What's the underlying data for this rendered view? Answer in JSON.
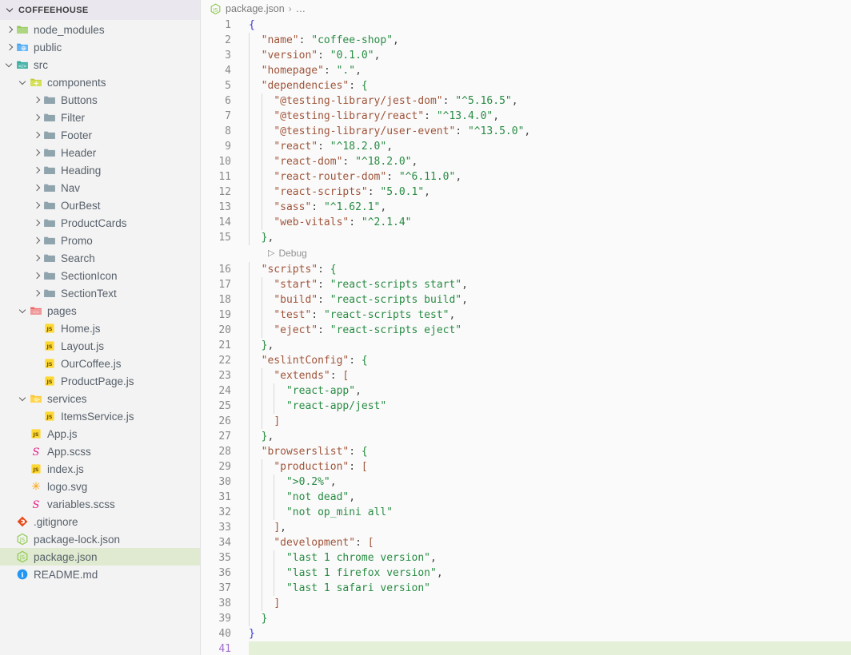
{
  "sidebar": {
    "title": "COFFEEHOUSE",
    "items": [
      {
        "label": "node_modules",
        "depth": 1,
        "kind": "folder",
        "icon": "folder-node-modules-icon",
        "state": "collapsed"
      },
      {
        "label": "public",
        "depth": 1,
        "kind": "folder",
        "icon": "folder-public-icon",
        "state": "collapsed"
      },
      {
        "label": "src",
        "depth": 1,
        "kind": "folder",
        "icon": "folder-src-icon",
        "state": "expanded"
      },
      {
        "label": "components",
        "depth": 2,
        "kind": "folder",
        "icon": "folder-components-icon",
        "state": "expanded"
      },
      {
        "label": "Buttons",
        "depth": 3,
        "kind": "folder",
        "icon": "folder-icon",
        "state": "collapsed"
      },
      {
        "label": "Filter",
        "depth": 3,
        "kind": "folder",
        "icon": "folder-icon",
        "state": "collapsed"
      },
      {
        "label": "Footer",
        "depth": 3,
        "kind": "folder",
        "icon": "folder-icon",
        "state": "collapsed"
      },
      {
        "label": "Header",
        "depth": 3,
        "kind": "folder",
        "icon": "folder-icon",
        "state": "collapsed"
      },
      {
        "label": "Heading",
        "depth": 3,
        "kind": "folder",
        "icon": "folder-icon",
        "state": "collapsed"
      },
      {
        "label": "Nav",
        "depth": 3,
        "kind": "folder",
        "icon": "folder-icon",
        "state": "collapsed"
      },
      {
        "label": "OurBest",
        "depth": 3,
        "kind": "folder",
        "icon": "folder-icon",
        "state": "collapsed"
      },
      {
        "label": "ProductCards",
        "depth": 3,
        "kind": "folder",
        "icon": "folder-icon",
        "state": "collapsed"
      },
      {
        "label": "Promo",
        "depth": 3,
        "kind": "folder",
        "icon": "folder-icon",
        "state": "collapsed"
      },
      {
        "label": "Search",
        "depth": 3,
        "kind": "folder",
        "icon": "folder-icon",
        "state": "collapsed"
      },
      {
        "label": "SectionIcon",
        "depth": 3,
        "kind": "folder",
        "icon": "folder-icon",
        "state": "collapsed"
      },
      {
        "label": "SectionText",
        "depth": 3,
        "kind": "folder",
        "icon": "folder-icon",
        "state": "collapsed"
      },
      {
        "label": "pages",
        "depth": 2,
        "kind": "folder",
        "icon": "folder-pages-icon",
        "state": "expanded"
      },
      {
        "label": "Home.js",
        "depth": 3,
        "kind": "file",
        "icon": "js-file-icon"
      },
      {
        "label": "Layout.js",
        "depth": 3,
        "kind": "file",
        "icon": "js-file-icon"
      },
      {
        "label": "OurCoffee.js",
        "depth": 3,
        "kind": "file",
        "icon": "js-file-icon"
      },
      {
        "label": "ProductPage.js",
        "depth": 3,
        "kind": "file",
        "icon": "js-file-icon"
      },
      {
        "label": "services",
        "depth": 2,
        "kind": "folder",
        "icon": "folder-services-icon",
        "state": "expanded"
      },
      {
        "label": "ItemsService.js",
        "depth": 3,
        "kind": "file",
        "icon": "js-file-icon"
      },
      {
        "label": "App.js",
        "depth": 2,
        "kind": "file",
        "icon": "js-file-icon"
      },
      {
        "label": "App.scss",
        "depth": 2,
        "kind": "file",
        "icon": "sass-file-icon"
      },
      {
        "label": "index.js",
        "depth": 2,
        "kind": "file",
        "icon": "js-file-icon"
      },
      {
        "label": "logo.svg",
        "depth": 2,
        "kind": "file",
        "icon": "svg-file-icon"
      },
      {
        "label": "variables.scss",
        "depth": 2,
        "kind": "file",
        "icon": "sass-file-icon"
      },
      {
        "label": ".gitignore",
        "depth": 1,
        "kind": "file",
        "icon": "git-file-icon"
      },
      {
        "label": "package-lock.json",
        "depth": 1,
        "kind": "file",
        "icon": "nodejs-file-icon"
      },
      {
        "label": "package.json",
        "depth": 1,
        "kind": "file",
        "icon": "nodejs-file-icon",
        "selected": true
      },
      {
        "label": "README.md",
        "depth": 1,
        "kind": "file",
        "icon": "info-file-icon"
      }
    ]
  },
  "editor": {
    "breadcrumb": {
      "file": "package.json",
      "separator": "›",
      "overflow": "…"
    },
    "codelens": {
      "label": "Debug",
      "after_line": 15
    },
    "active_line": 41,
    "lines": [
      {
        "n": 1,
        "indent": 0,
        "tokens": [
          {
            "t": "brace",
            "v": "{"
          }
        ]
      },
      {
        "n": 2,
        "indent": 1,
        "tokens": [
          {
            "t": "key",
            "v": "\"name\""
          },
          {
            "t": "punc",
            "v": ": "
          },
          {
            "t": "str",
            "v": "\"coffee-shop\""
          },
          {
            "t": "punc",
            "v": ","
          }
        ]
      },
      {
        "n": 3,
        "indent": 1,
        "tokens": [
          {
            "t": "key",
            "v": "\"version\""
          },
          {
            "t": "punc",
            "v": ": "
          },
          {
            "t": "str",
            "v": "\"0.1.0\""
          },
          {
            "t": "punc",
            "v": ","
          }
        ]
      },
      {
        "n": 4,
        "indent": 1,
        "tokens": [
          {
            "t": "key",
            "v": "\"homepage\""
          },
          {
            "t": "punc",
            "v": ": "
          },
          {
            "t": "str",
            "v": "\".\""
          },
          {
            "t": "punc",
            "v": ","
          }
        ]
      },
      {
        "n": 5,
        "indent": 1,
        "tokens": [
          {
            "t": "key",
            "v": "\"dependencies\""
          },
          {
            "t": "punc",
            "v": ": "
          },
          {
            "t": "brace2",
            "v": "{"
          }
        ]
      },
      {
        "n": 6,
        "indent": 2,
        "tokens": [
          {
            "t": "key",
            "v": "\"@testing-library/jest-dom\""
          },
          {
            "t": "punc",
            "v": ": "
          },
          {
            "t": "str",
            "v": "\"^5.16.5\""
          },
          {
            "t": "punc",
            "v": ","
          }
        ]
      },
      {
        "n": 7,
        "indent": 2,
        "tokens": [
          {
            "t": "key",
            "v": "\"@testing-library/react\""
          },
          {
            "t": "punc",
            "v": ": "
          },
          {
            "t": "str",
            "v": "\"^13.4.0\""
          },
          {
            "t": "punc",
            "v": ","
          }
        ]
      },
      {
        "n": 8,
        "indent": 2,
        "tokens": [
          {
            "t": "key",
            "v": "\"@testing-library/user-event\""
          },
          {
            "t": "punc",
            "v": ": "
          },
          {
            "t": "str",
            "v": "\"^13.5.0\""
          },
          {
            "t": "punc",
            "v": ","
          }
        ]
      },
      {
        "n": 9,
        "indent": 2,
        "tokens": [
          {
            "t": "key",
            "v": "\"react\""
          },
          {
            "t": "punc",
            "v": ": "
          },
          {
            "t": "str",
            "v": "\"^18.2.0\""
          },
          {
            "t": "punc",
            "v": ","
          }
        ]
      },
      {
        "n": 10,
        "indent": 2,
        "tokens": [
          {
            "t": "key",
            "v": "\"react-dom\""
          },
          {
            "t": "punc",
            "v": ": "
          },
          {
            "t": "str",
            "v": "\"^18.2.0\""
          },
          {
            "t": "punc",
            "v": ","
          }
        ]
      },
      {
        "n": 11,
        "indent": 2,
        "tokens": [
          {
            "t": "key",
            "v": "\"react-router-dom\""
          },
          {
            "t": "punc",
            "v": ": "
          },
          {
            "t": "str",
            "v": "\"^6.11.0\""
          },
          {
            "t": "punc",
            "v": ","
          }
        ]
      },
      {
        "n": 12,
        "indent": 2,
        "tokens": [
          {
            "t": "key",
            "v": "\"react-scripts\""
          },
          {
            "t": "punc",
            "v": ": "
          },
          {
            "t": "str",
            "v": "\"5.0.1\""
          },
          {
            "t": "punc",
            "v": ","
          }
        ]
      },
      {
        "n": 13,
        "indent": 2,
        "tokens": [
          {
            "t": "key",
            "v": "\"sass\""
          },
          {
            "t": "punc",
            "v": ": "
          },
          {
            "t": "str",
            "v": "\"^1.62.1\""
          },
          {
            "t": "punc",
            "v": ","
          }
        ]
      },
      {
        "n": 14,
        "indent": 2,
        "tokens": [
          {
            "t": "key",
            "v": "\"web-vitals\""
          },
          {
            "t": "punc",
            "v": ": "
          },
          {
            "t": "str",
            "v": "\"^2.1.4\""
          }
        ]
      },
      {
        "n": 15,
        "indent": 1,
        "tokens": [
          {
            "t": "brace2",
            "v": "}"
          },
          {
            "t": "punc",
            "v": ","
          }
        ]
      },
      {
        "n": 16,
        "indent": 1,
        "tokens": [
          {
            "t": "key",
            "v": "\"scripts\""
          },
          {
            "t": "punc",
            "v": ": "
          },
          {
            "t": "brace2",
            "v": "{"
          }
        ]
      },
      {
        "n": 17,
        "indent": 2,
        "tokens": [
          {
            "t": "key",
            "v": "\"start\""
          },
          {
            "t": "punc",
            "v": ": "
          },
          {
            "t": "str",
            "v": "\"react-scripts start\""
          },
          {
            "t": "punc",
            "v": ","
          }
        ]
      },
      {
        "n": 18,
        "indent": 2,
        "tokens": [
          {
            "t": "key",
            "v": "\"build\""
          },
          {
            "t": "punc",
            "v": ": "
          },
          {
            "t": "str",
            "v": "\"react-scripts build\""
          },
          {
            "t": "punc",
            "v": ","
          }
        ]
      },
      {
        "n": 19,
        "indent": 2,
        "tokens": [
          {
            "t": "key",
            "v": "\"test\""
          },
          {
            "t": "punc",
            "v": ": "
          },
          {
            "t": "str",
            "v": "\"react-scripts test\""
          },
          {
            "t": "punc",
            "v": ","
          }
        ]
      },
      {
        "n": 20,
        "indent": 2,
        "tokens": [
          {
            "t": "key",
            "v": "\"eject\""
          },
          {
            "t": "punc",
            "v": ": "
          },
          {
            "t": "str",
            "v": "\"react-scripts eject\""
          }
        ]
      },
      {
        "n": 21,
        "indent": 1,
        "tokens": [
          {
            "t": "brace2",
            "v": "}"
          },
          {
            "t": "punc",
            "v": ","
          }
        ]
      },
      {
        "n": 22,
        "indent": 1,
        "tokens": [
          {
            "t": "key",
            "v": "\"eslintConfig\""
          },
          {
            "t": "punc",
            "v": ": "
          },
          {
            "t": "brace2",
            "v": "{"
          }
        ]
      },
      {
        "n": 23,
        "indent": 2,
        "tokens": [
          {
            "t": "key",
            "v": "\"extends\""
          },
          {
            "t": "punc",
            "v": ": "
          },
          {
            "t": "brace3",
            "v": "["
          }
        ]
      },
      {
        "n": 24,
        "indent": 3,
        "tokens": [
          {
            "t": "str",
            "v": "\"react-app\""
          },
          {
            "t": "punc",
            "v": ","
          }
        ]
      },
      {
        "n": 25,
        "indent": 3,
        "tokens": [
          {
            "t": "str",
            "v": "\"react-app/jest\""
          }
        ]
      },
      {
        "n": 26,
        "indent": 2,
        "tokens": [
          {
            "t": "brace3",
            "v": "]"
          }
        ]
      },
      {
        "n": 27,
        "indent": 1,
        "tokens": [
          {
            "t": "brace2",
            "v": "}"
          },
          {
            "t": "punc",
            "v": ","
          }
        ]
      },
      {
        "n": 28,
        "indent": 1,
        "tokens": [
          {
            "t": "key",
            "v": "\"browserslist\""
          },
          {
            "t": "punc",
            "v": ": "
          },
          {
            "t": "brace2",
            "v": "{"
          }
        ]
      },
      {
        "n": 29,
        "indent": 2,
        "tokens": [
          {
            "t": "key",
            "v": "\"production\""
          },
          {
            "t": "punc",
            "v": ": "
          },
          {
            "t": "brace3",
            "v": "["
          }
        ]
      },
      {
        "n": 30,
        "indent": 3,
        "tokens": [
          {
            "t": "str",
            "v": "\">0.2%\""
          },
          {
            "t": "punc",
            "v": ","
          }
        ]
      },
      {
        "n": 31,
        "indent": 3,
        "tokens": [
          {
            "t": "str",
            "v": "\"not dead\""
          },
          {
            "t": "punc",
            "v": ","
          }
        ]
      },
      {
        "n": 32,
        "indent": 3,
        "tokens": [
          {
            "t": "str",
            "v": "\"not op_mini all\""
          }
        ]
      },
      {
        "n": 33,
        "indent": 2,
        "tokens": [
          {
            "t": "brace3",
            "v": "]"
          },
          {
            "t": "punc",
            "v": ","
          }
        ]
      },
      {
        "n": 34,
        "indent": 2,
        "tokens": [
          {
            "t": "key",
            "v": "\"development\""
          },
          {
            "t": "punc",
            "v": ": "
          },
          {
            "t": "brace3",
            "v": "["
          }
        ]
      },
      {
        "n": 35,
        "indent": 3,
        "tokens": [
          {
            "t": "str",
            "v": "\"last 1 chrome version\""
          },
          {
            "t": "punc",
            "v": ","
          }
        ]
      },
      {
        "n": 36,
        "indent": 3,
        "tokens": [
          {
            "t": "str",
            "v": "\"last 1 firefox version\""
          },
          {
            "t": "punc",
            "v": ","
          }
        ]
      },
      {
        "n": 37,
        "indent": 3,
        "tokens": [
          {
            "t": "str",
            "v": "\"last 1 safari version\""
          }
        ]
      },
      {
        "n": 38,
        "indent": 2,
        "tokens": [
          {
            "t": "brace3",
            "v": "]"
          }
        ]
      },
      {
        "n": 39,
        "indent": 1,
        "tokens": [
          {
            "t": "brace2",
            "v": "}"
          }
        ]
      },
      {
        "n": 40,
        "indent": 0,
        "tokens": [
          {
            "t": "brace",
            "v": "}"
          }
        ]
      },
      {
        "n": 41,
        "indent": 0,
        "tokens": []
      }
    ]
  },
  "colors": {
    "sidebar_bg": "#f3f3f3",
    "sidebar_header_bg": "#ebe7ef",
    "selected_row_bg": "#dfead0",
    "editor_bg": "#fafafa",
    "active_line_bg": "#e4f0d8",
    "active_line_number": "#a06fd0",
    "json_key": "#a0553b",
    "json_string": "#298c44",
    "brace_level0": "#3a3ad4",
    "brace_level1": "#1f8a3a",
    "brace_level2": "#a0553b"
  }
}
